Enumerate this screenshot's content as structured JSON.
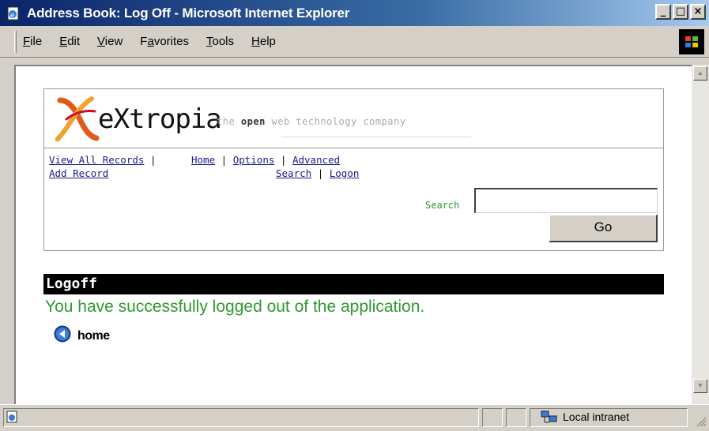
{
  "window": {
    "title": "Address Book: Log Off - Microsoft Internet Explorer",
    "buttons": {
      "minimize": "_",
      "maximize": "□",
      "close": "×"
    }
  },
  "menu": {
    "items": [
      {
        "label": "File",
        "accel": "F",
        "rest": "ile"
      },
      {
        "label": "Edit",
        "accel": "E",
        "rest": "dit"
      },
      {
        "label": "View",
        "accel": "V",
        "rest": "iew"
      },
      {
        "label": "Favorites",
        "pre": "F",
        "accel": "a",
        "rest": "vorites"
      },
      {
        "label": "Tools",
        "accel": "T",
        "rest": "ools"
      },
      {
        "label": "Help",
        "accel": "H",
        "rest": "elp"
      }
    ]
  },
  "page": {
    "logo_word": "eXtropia",
    "tagline_pre": "the ",
    "tagline_bold": "open",
    "tagline_post": " web technology company",
    "nav": {
      "view_all": "View All Records",
      "add_record": "Add Record",
      "home": "Home",
      "options": "Options",
      "advanced": "Advanced",
      "search": "Search",
      "logon": "Logon",
      "sep": "|"
    },
    "search_label": "Search",
    "search_value": "",
    "go_label": "Go",
    "section_title": "Logoff",
    "message": "You have successfully logged out of the application.",
    "home_link": "home"
  },
  "status": {
    "zone": "Local intranet"
  },
  "colors": {
    "accent_green": "#2e9a2e",
    "title_bar": "#0a246a"
  }
}
